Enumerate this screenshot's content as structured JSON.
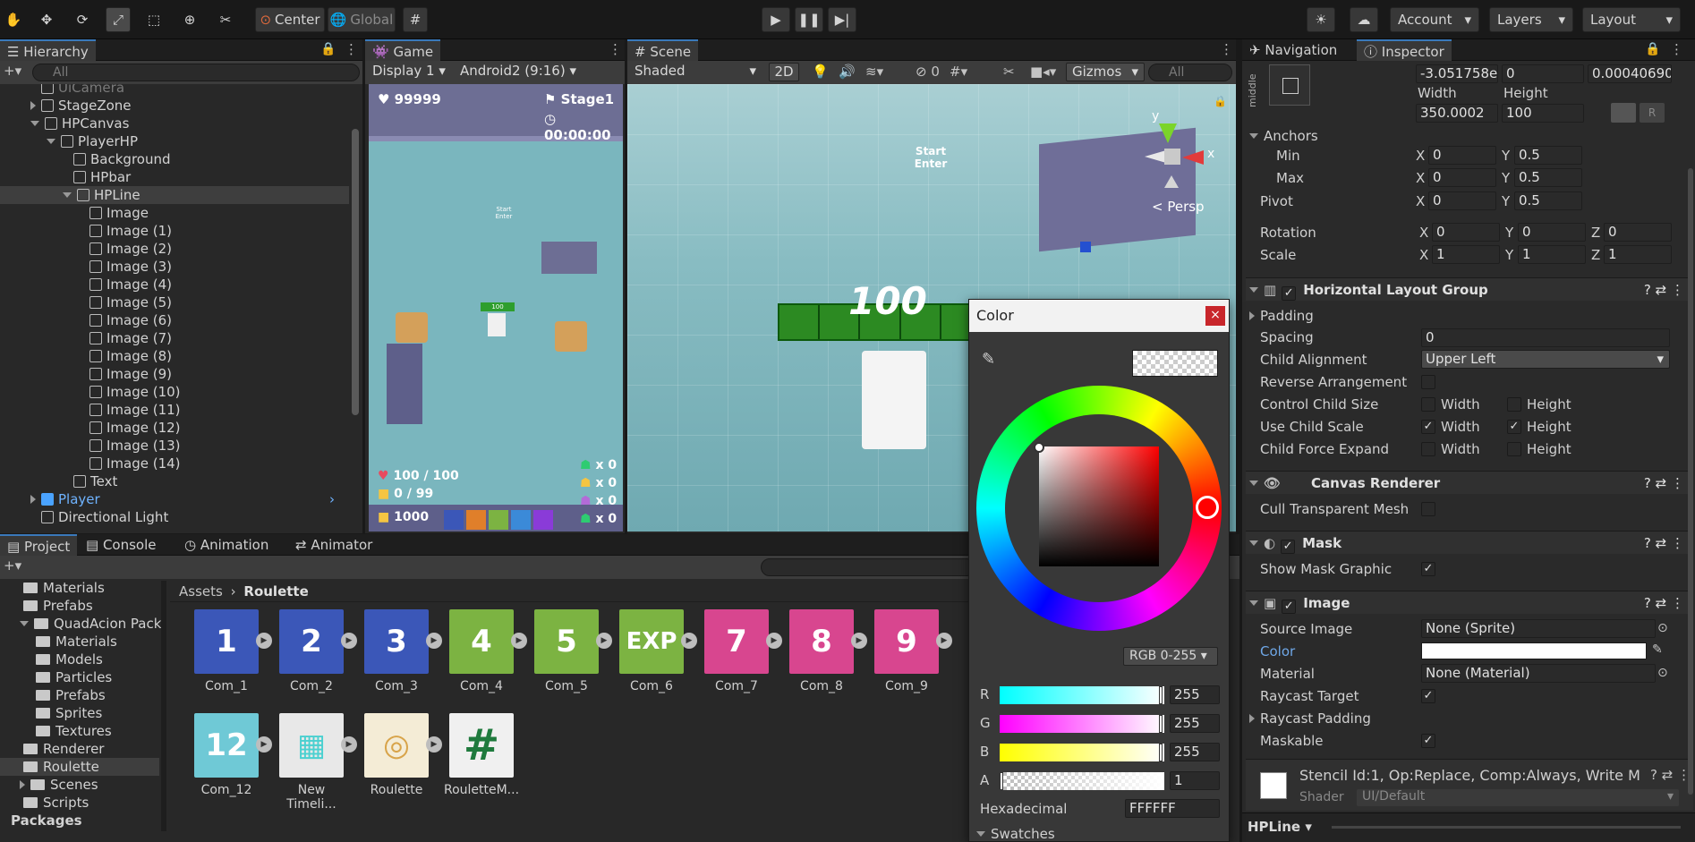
{
  "toolbar": {
    "center_label": "Center",
    "global_label": "Global",
    "account_label": "Account",
    "layers_label": "Layers",
    "layout_label": "Layout"
  },
  "hierarchy": {
    "tab_label": "Hierarchy",
    "search_placeholder": "All",
    "items": [
      {
        "label": "UiCamera",
        "indent": 1,
        "arrow": "none",
        "dim": true
      },
      {
        "label": "StageZone",
        "indent": 1,
        "arrow": "right"
      },
      {
        "label": "HPCanvas",
        "indent": 1,
        "arrow": "down"
      },
      {
        "label": "PlayerHP",
        "indent": 2,
        "arrow": "down"
      },
      {
        "label": "Background",
        "indent": 3,
        "arrow": "none"
      },
      {
        "label": "HPbar",
        "indent": 3,
        "arrow": "none"
      },
      {
        "label": "HPLine",
        "indent": 3,
        "arrow": "down",
        "selected": true
      },
      {
        "label": "Image",
        "indent": 4,
        "arrow": "none"
      },
      {
        "label": "Image (1)",
        "indent": 4,
        "arrow": "none"
      },
      {
        "label": "Image (2)",
        "indent": 4,
        "arrow": "none"
      },
      {
        "label": "Image (3)",
        "indent": 4,
        "arrow": "none"
      },
      {
        "label": "Image (4)",
        "indent": 4,
        "arrow": "none"
      },
      {
        "label": "Image (5)",
        "indent": 4,
        "arrow": "none"
      },
      {
        "label": "Image (6)",
        "indent": 4,
        "arrow": "none"
      },
      {
        "label": "Image (7)",
        "indent": 4,
        "arrow": "none"
      },
      {
        "label": "Image (8)",
        "indent": 4,
        "arrow": "none"
      },
      {
        "label": "Image (9)",
        "indent": 4,
        "arrow": "none"
      },
      {
        "label": "Image (10)",
        "indent": 4,
        "arrow": "none"
      },
      {
        "label": "Image (11)",
        "indent": 4,
        "arrow": "none"
      },
      {
        "label": "Image (12)",
        "indent": 4,
        "arrow": "none"
      },
      {
        "label": "Image (13)",
        "indent": 4,
        "arrow": "none"
      },
      {
        "label": "Image (14)",
        "indent": 4,
        "arrow": "none"
      },
      {
        "label": "Text",
        "indent": 3,
        "arrow": "none"
      },
      {
        "label": "Player",
        "indent": 1,
        "arrow": "right",
        "blue": true
      },
      {
        "label": "Directional Light",
        "indent": 1,
        "arrow": "none"
      }
    ]
  },
  "game": {
    "tab_label": "Game",
    "display_label": "Display 1",
    "resolution_label": "Android2 (9:16)",
    "coins": "99999",
    "stage": "Stage1",
    "timer": "00:00:00",
    "hp": "100 / 100",
    "count": "0 / 99",
    "gold": "1000",
    "counters": [
      "x 0",
      "x 0",
      "x 0",
      "x 0"
    ],
    "sign_text": "Start\nEnter",
    "hp_small": "100"
  },
  "scene": {
    "tab_label": "Scene",
    "shading_label": "Shaded",
    "mode_2d": "2D",
    "hidden_count": "0",
    "gizmos_label": "Gizmos",
    "search_placeholder": "All",
    "persp_label": "< Persp",
    "hp_text": "100",
    "sign_text": "Start\nEnter",
    "axis_y": "y",
    "axis_x": "x"
  },
  "color_picker": {
    "title": "Color",
    "mode_label": "RGB 0-255",
    "r_label": "R",
    "r_value": "255",
    "g_label": "G",
    "g_value": "255",
    "b_label": "B",
    "b_value": "255",
    "a_label": "A",
    "a_value": "1",
    "hex_label": "Hexadecimal",
    "hex_value": "FFFFFF",
    "swatches_label": "Swatches"
  },
  "project": {
    "tabs": [
      "Project",
      "Console",
      "Animation",
      "Animator"
    ],
    "breadcrumb_root": "Assets",
    "breadcrumb_current": "Roulette",
    "tree": [
      {
        "label": "Materials",
        "indent": 1
      },
      {
        "label": "Prefabs",
        "indent": 1
      },
      {
        "label": "QuadAcion Pack",
        "indent": 1,
        "arrow": "down"
      },
      {
        "label": "Materials",
        "indent": 2
      },
      {
        "label": "Models",
        "indent": 2
      },
      {
        "label": "Particles",
        "indent": 2
      },
      {
        "label": "Prefabs",
        "indent": 2
      },
      {
        "label": "Sprites",
        "indent": 2
      },
      {
        "label": "Textures",
        "indent": 2
      },
      {
        "label": "Renderer",
        "indent": 1
      },
      {
        "label": "Roulette",
        "indent": 1,
        "selected": true
      },
      {
        "label": "Scenes",
        "indent": 1,
        "arrow": "right"
      },
      {
        "label": "Scripts",
        "indent": 1
      },
      {
        "label": "Packages",
        "indent": 0,
        "bold": true
      }
    ],
    "assets": [
      {
        "label": "Com_1",
        "color": "#3b57b8",
        "glyph": "1"
      },
      {
        "label": "Com_2",
        "color": "#3b57b8",
        "glyph": "2"
      },
      {
        "label": "Com_3",
        "color": "#3b57b8",
        "glyph": "3"
      },
      {
        "label": "Com_4",
        "color": "#7cb342",
        "glyph": "4"
      },
      {
        "label": "Com_5",
        "color": "#7cb342",
        "glyph": "5"
      },
      {
        "label": "Com_6",
        "color": "#7cb342",
        "glyph": "EXP"
      },
      {
        "label": "Com_7",
        "color": "#d8468f",
        "glyph": "7"
      },
      {
        "label": "Com_8",
        "color": "#d8468f",
        "glyph": "8"
      },
      {
        "label": "Com_9",
        "color": "#d8468f",
        "glyph": "9"
      },
      {
        "label": "Com_12",
        "color": "#6fc9d6",
        "glyph": "12"
      },
      {
        "label": "New Timeli...",
        "color": "#e8e8e8",
        "glyph": "▦"
      },
      {
        "label": "Roulette",
        "color": "#f4ecd6",
        "glyph": "◎"
      },
      {
        "label": "RouletteM...",
        "color": "#f0f0f0",
        "glyph": "#"
      }
    ]
  },
  "inspector": {
    "nav_tab": "Navigation",
    "inspector_tab": "Inspector",
    "anchor_preset_label": "middle",
    "pos_y_value": "-3.051758e",
    "pos_z_value": "0",
    "pos_extra_value": "0.00040690",
    "width_label": "Width",
    "height_label": "Height",
    "width_value": "350.0002",
    "height_value": "100",
    "anchors_label": "Anchors",
    "min_label": "Min",
    "max_label": "Max",
    "pivot_label": "Pivot",
    "rotation_label": "Rotation",
    "scale_label": "Scale",
    "min_x": "0",
    "min_y": "0.5",
    "max_x": "0",
    "max_y": "0.5",
    "pivot_x": "0",
    "pivot_y": "0.5",
    "rot_x": "0",
    "rot_y": "0",
    "rot_z": "0",
    "scale_x": "1",
    "scale_y": "1",
    "scale_z": "1",
    "hlg_title": "Horizontal Layout Group",
    "padding_label": "Padding",
    "spacing_label": "Spacing",
    "spacing_value": "0",
    "child_alignment_label": "Child Alignment",
    "child_alignment_value": "Upper Left",
    "reverse_label": "Reverse Arrangement",
    "control_size_label": "Control Child Size",
    "use_scale_label": "Use Child Scale",
    "force_expand_label": "Child Force Expand",
    "opt_width": "Width",
    "opt_height": "Height",
    "canvas_renderer_title": "Canvas Renderer",
    "cull_label": "Cull Transparent Mesh",
    "mask_title": "Mask",
    "show_mask_label": "Show Mask Graphic",
    "image_title": "Image",
    "source_image_label": "Source Image",
    "source_image_value": "None (Sprite)",
    "color_label": "Color",
    "material_label": "Material",
    "material_value": "None (Material)",
    "raycast_target_label": "Raycast Target",
    "raycast_padding_label": "Raycast Padding",
    "maskable_label": "Maskable",
    "stencil_text": "Stencil Id:1, Op:Replace, Comp:Always, Write M",
    "shader_label": "Shader",
    "shader_value": "UI/Default",
    "footer_label": "HPLine"
  }
}
